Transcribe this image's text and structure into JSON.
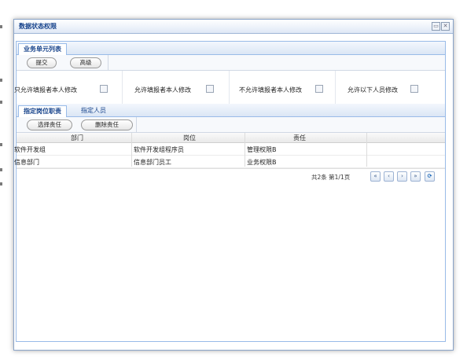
{
  "window": {
    "title": "数据状态权限",
    "minimize_icon": "minimize-icon",
    "close_icon": "close-icon"
  },
  "business_panel": {
    "tab": "业务单元列表",
    "buttons": {
      "submit": "提交",
      "advanced": "高级"
    },
    "permissions": [
      {
        "label": "只允许填报者本人修改",
        "checked": false
      },
      {
        "label": "允许填报者本人修改",
        "checked": false
      },
      {
        "label": "不允许填报者本人修改",
        "checked": false
      },
      {
        "label": "允许以下人员修改",
        "checked": false
      }
    ]
  },
  "assign_panel": {
    "tabs": [
      {
        "label": "指定岗位职责",
        "active": true
      },
      {
        "label": "指定人员",
        "active": false
      }
    ],
    "buttons": {
      "select": "选择责任",
      "delete": "删除责任"
    },
    "columns": [
      "部门",
      "岗位",
      "责任"
    ],
    "rows": [
      [
        "软件开发组",
        "软件开发组程序员",
        "管理权限B"
      ],
      [
        "信息部门",
        "信息部门员工",
        "业务权限B"
      ]
    ],
    "pager": {
      "summary": "共2条 第1/1页",
      "icons": [
        "first-page-icon",
        "prev-page-icon",
        "next-page-icon",
        "last-page-icon",
        "refresh-icon"
      ]
    }
  }
}
